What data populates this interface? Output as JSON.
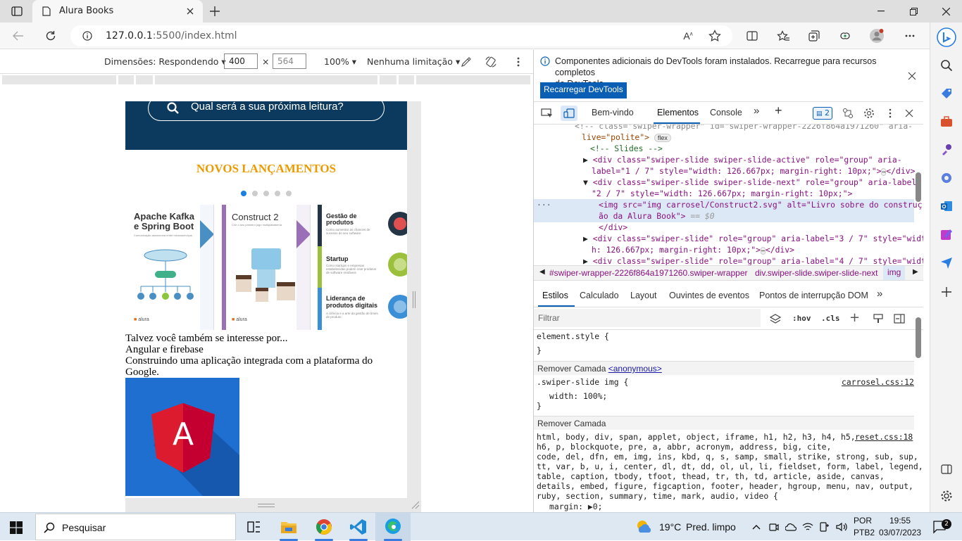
{
  "browser": {
    "tab_title": "Alura Books",
    "url_host": "127.0.0.1",
    "url_rest": ":5500/index.html"
  },
  "device_toolbar": {
    "dimensions_label": "Dimensões: Respondendo",
    "width_value": "400",
    "times": "×",
    "height_value": "564",
    "zoom": "100%",
    "throttle": "Nenhuma limitação"
  },
  "page": {
    "search_placeholder": "Qual será a sua próxima leitura?",
    "section_title": "NOVOS LANÇAMENTOS",
    "carousel_dots": 5,
    "carousel_active": 0,
    "books": [
      {
        "title_line1": "Apache Kafka",
        "title_line2": "e Spring Boot",
        "subtitle": "Comunicação assíncrona entre microsserviços",
        "accent": "#4a8fc4"
      },
      {
        "title_line1": "Construct 2",
        "subtitle": "Crie o seu primeiro jogo multiplataforma",
        "accent": "#9b6fb8"
      },
      {
        "items": [
          {
            "title": "Gestão de produtos",
            "desc": "Como aumentar as chances de sucesso do seu software",
            "color": "#e05050"
          },
          {
            "title": "Startup",
            "desc": "Como startups e empresas estabelecidas podem criar produtos de software rentáveis",
            "color": "#9bc13c"
          },
          {
            "title": "Liderança de produtos digitais",
            "desc": "A ciência e a arte da gestão de times de produto",
            "color": "#3b8fd6"
          }
        ]
      }
    ],
    "book_brand": "alura",
    "suggest_text": "Talvez você também se interesse por...",
    "suggest_title": "Angular e firebase",
    "suggest_desc_line1": "Construindo uma aplicação integrada com a plataforma do",
    "suggest_desc_line2": "Google.",
    "angular_letter": "A"
  },
  "devtools": {
    "notice_line1": "Componentes adicionais do DevTools foram instalados. Recarregue para recursos completos",
    "notice_line2": "do DevTools.",
    "reload_button": "Recarregar DevTools",
    "tabs": [
      "Bem-vindo",
      "Elementos",
      "Console"
    ],
    "active_tab": "Elementos",
    "issues_count": "2",
    "code_lines": {
      "l0": "<!-- class=\"swiper-wrapper\" id=\"swiper-wrapper-2226f864a1971260\" aria-",
      "l1a": "live=\"polite\">",
      "l1b": "flex",
      "l2": "<!-- Slides -->",
      "l3a": "<div class=\"swiper-slide swiper-slide-active\" role=\"group\" aria-",
      "l3b": "label=\"1 / 7\" style=\"width: 126.667px; margin-right: 10px;\">",
      "l3c": "</div>",
      "l4a": "<div class=\"swiper-slide swiper-slide-next\" role=\"group\" aria-label=",
      "l4b": "\"2 / 7\" style=\"width: 126.667px; margin-right: 10px;\">",
      "l5a": "<img src=\"img carrosel/Construct2.svg\" alt=\"Livro sobre do construç",
      "l5b": "ão da Alura Book\">",
      "l5c": "== $0",
      "l6": "</div>",
      "l7a": "<div class=\"swiper-slide\" role=\"group\" aria-label=\"3 / 7\" style=\"widt",
      "l7b": "h: 126.667px; margin-right: 10px;\">",
      "l7c": "</div>",
      "l8": "<div class=\"swiper-slide\" role=\"group\" aria-label=\"4 / 7\" style=\"widt"
    },
    "breadcrumb_1": "#swiper-wrapper-2226f864a1971260.swiper-wrapper",
    "breadcrumb_2": "div.swiper-slide.swiper-slide-next",
    "breadcrumb_3": "img",
    "style_tabs": [
      "Estilos",
      "Calculado",
      "Layout",
      "Ouvintes de eventos",
      "Pontos de interrupção DOM"
    ],
    "filter_placeholder": "Filtrar",
    "hov": ":hov",
    "cls": ".cls",
    "element_style": "element.style {",
    "close_brace": "}",
    "layer_label": "Remover Camada",
    "anonymous": "<anonymous>",
    "rule1_selector": ".swiper-slide img {",
    "rule1_source": "carrosel.css:12",
    "rule1_prop": "width: 100%;",
    "layer2_label": "Remover Camada",
    "rule2_selectors": [
      "html, body, div, span, applet, object, iframe, h1, h2, h3, h4, h5,",
      "h6, p, blockquote, pre, a, abbr, acronym, address, big, cite,",
      "code, del, dfn, em, img, ins, kbd, q, s, samp, small, strike, strong, sub, sup,",
      "tt, var, b, u, i, center, dl, dt, dd, ol, ul, li, fieldset, form, label, legend,",
      "table, caption, tbody, tfoot, thead, tr, th, td, article, aside, canvas,",
      "details, embed, figure, figcaption, footer, header, hgroup, menu, nav, output,",
      "ruby, section, summary, time, mark, audio, video {"
    ],
    "rule2_source": "reset.css:18",
    "rule2_prop": "margin: ▶0;"
  },
  "taskbar": {
    "search_label": "Pesquisar",
    "weather_temp": "19°C",
    "weather_desc": "Pred. limpo",
    "lang_line1": "POR",
    "lang_line2": "PTB2",
    "time": "19:55",
    "date": "03/07/2023",
    "notif_count": "2"
  },
  "colors": {
    "hero": "#0b3a5e",
    "accent_orange": "#eb9b00",
    "devtools_blue": "#0a5fb4",
    "angular_bg": "#1f6fd1",
    "angular_red": "#dd1b2e"
  }
}
